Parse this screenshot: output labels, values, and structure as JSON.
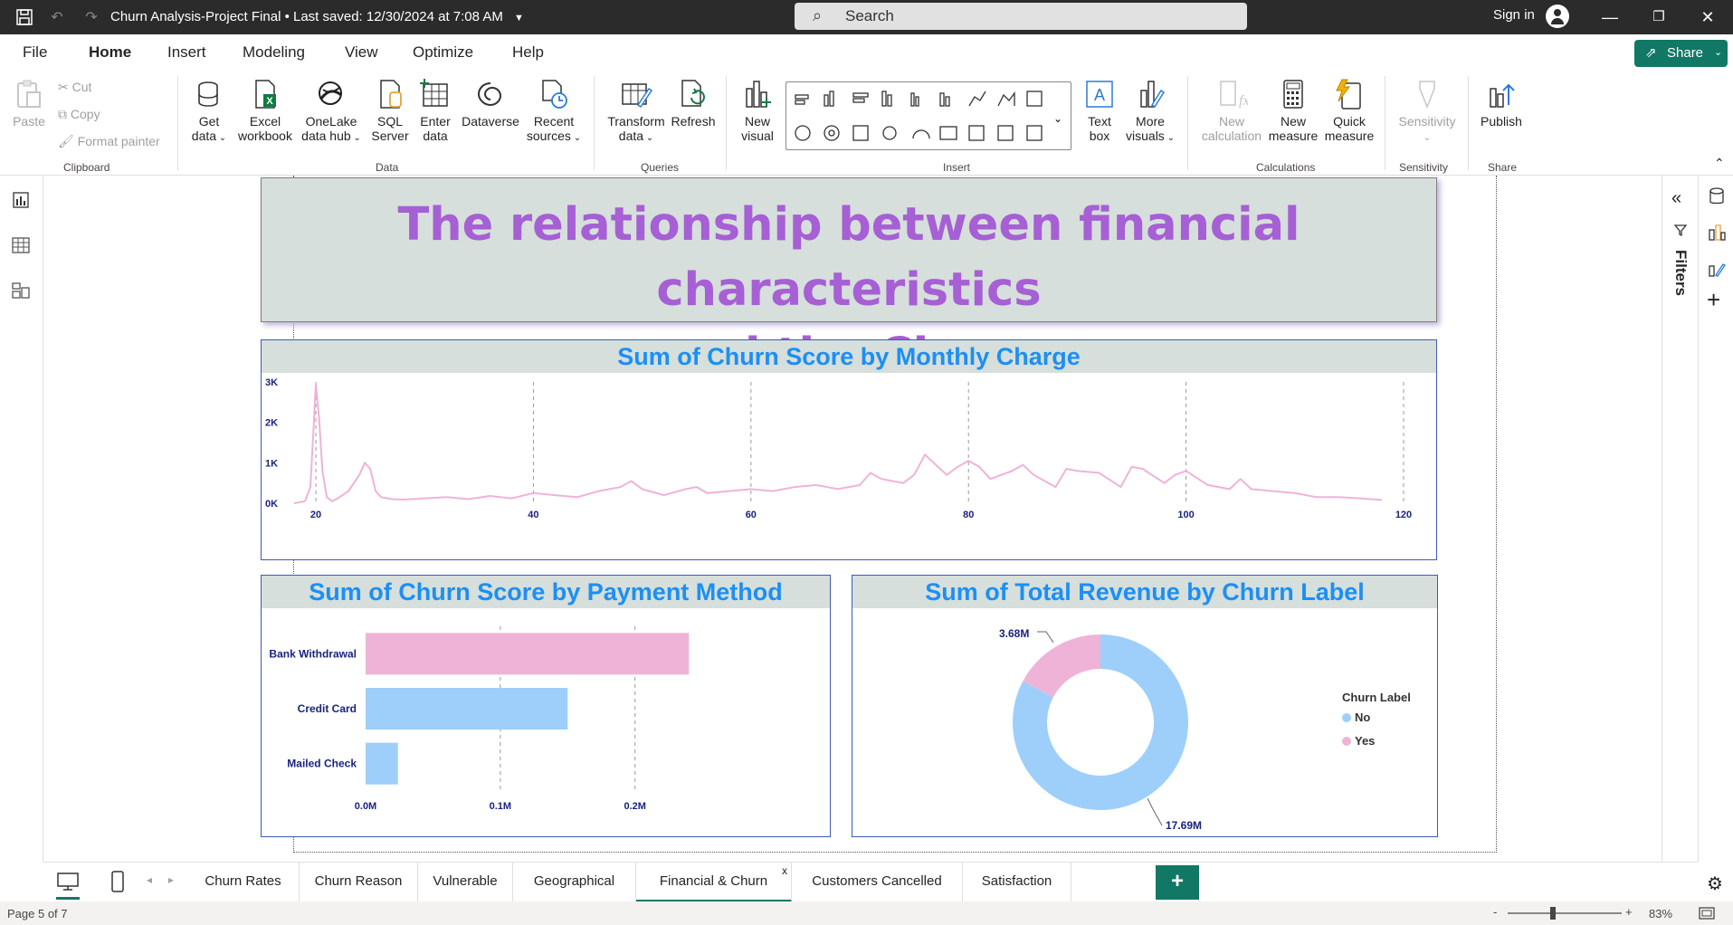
{
  "titlebar": {
    "doc_title": "Churn Analysis-Project Final • Last saved: 12/30/2024 at 7:08 AM",
    "search_placeholder": "Search",
    "sign_in": "Sign in"
  },
  "menu": {
    "items": [
      "File",
      "Home",
      "Insert",
      "Modeling",
      "View",
      "Optimize",
      "Help"
    ],
    "active": "Home",
    "share": "Share"
  },
  "ribbon": {
    "clipboard": {
      "paste": "Paste",
      "cut": "Cut",
      "copy": "Copy",
      "format_painter": "Format painter",
      "group": "Clipboard"
    },
    "data": {
      "get_data": [
        "Get",
        "data"
      ],
      "excel": [
        "Excel",
        "workbook"
      ],
      "onelake": [
        "OneLake",
        "data hub"
      ],
      "sql": [
        "SQL",
        "Server"
      ],
      "enter": [
        "Enter",
        "data"
      ],
      "dataverse": "Dataverse",
      "recent": [
        "Recent",
        "sources"
      ],
      "group": "Data"
    },
    "queries": {
      "transform": [
        "Transform",
        "data"
      ],
      "refresh": "Refresh",
      "group": "Queries"
    },
    "insert": {
      "new_visual": [
        "New",
        "visual"
      ],
      "text_box": [
        "Text",
        "box"
      ],
      "more_visuals": [
        "More",
        "visuals"
      ],
      "group": "Insert"
    },
    "calculations": {
      "new_calc": [
        "New",
        "calculation"
      ],
      "new_measure": [
        "New",
        "measure"
      ],
      "quick_measure": [
        "Quick",
        "measure"
      ],
      "group": "Calculations"
    },
    "sensitivity": {
      "label": "Sensitivity",
      "group": "Sensitivity"
    },
    "share": {
      "publish": "Publish",
      "group": "Share"
    }
  },
  "report": {
    "title": "The relationship between financial characteristics and the Churn",
    "title_line1": "The relationship between financial characteristics",
    "title_line2": "and the Churn"
  },
  "line_visual": {
    "title": "Sum of Churn Score by Monthly Charge"
  },
  "bar_visual": {
    "title": "Sum of Churn Score by Payment Method"
  },
  "donut_visual": {
    "title": "Sum of Total Revenue by Churn Label",
    "legend_title": "Churn Label"
  },
  "chart_data": [
    {
      "type": "line",
      "title": "Sum of Churn Score by Monthly Charge",
      "xlabel": "",
      "ylabel": "",
      "xlim": [
        18,
        120
      ],
      "ylim": [
        0,
        3000
      ],
      "x_ticks": [
        "20",
        "40",
        "60",
        "80",
        "100",
        "120"
      ],
      "y_ticks": [
        "0K",
        "1K",
        "2K",
        "3K"
      ],
      "grid": "vertical dashed",
      "color": "#efb3d8",
      "x": [
        18,
        19,
        19.5,
        19.8,
        20,
        20.3,
        20.6,
        21,
        21.5,
        22,
        23,
        24,
        24.5,
        25,
        25.5,
        26,
        27,
        28,
        30,
        32,
        34,
        36,
        38,
        40,
        42,
        44,
        46,
        48,
        49,
        50,
        52,
        54,
        55,
        56,
        58,
        60,
        62,
        64,
        66,
        68,
        70,
        71,
        72,
        74,
        75,
        76,
        78,
        79,
        80,
        81,
        82,
        84,
        85,
        86,
        88,
        89,
        90,
        92,
        94,
        95,
        96,
        98,
        99,
        100,
        102,
        104,
        105,
        106,
        108,
        110,
        112,
        114,
        116,
        118
      ],
      "y": [
        0,
        50,
        400,
        1900,
        2950,
        2100,
        800,
        150,
        50,
        120,
        300,
        700,
        1000,
        850,
        300,
        150,
        100,
        90,
        120,
        150,
        100,
        180,
        120,
        250,
        200,
        150,
        300,
        400,
        550,
        350,
        200,
        350,
        400,
        250,
        300,
        350,
        300,
        400,
        450,
        350,
        450,
        750,
        600,
        500,
        700,
        1200,
        700,
        900,
        1050,
        900,
        600,
        800,
        950,
        700,
        400,
        850,
        800,
        750,
        400,
        900,
        850,
        500,
        700,
        800,
        450,
        350,
        600,
        350,
        300,
        250,
        150,
        150,
        120,
        80
      ]
    },
    {
      "type": "bar",
      "orientation": "horizontal",
      "title": "Sum of Churn Score by Payment Method",
      "categories": [
        "Bank Withdrawal",
        "Credit Card",
        "Mailed Check"
      ],
      "values": [
        240000,
        150000,
        24000
      ],
      "colors": [
        "#efb3d8",
        "#9dcffa",
        "#9dcffa"
      ],
      "x_ticks": [
        "0.0M",
        "0.1M",
        "0.2M"
      ],
      "xlim": [
        0,
        0.2667
      ]
    },
    {
      "type": "pie",
      "style": "donut",
      "title": "Sum of Total Revenue by Churn Label",
      "legend_title": "Churn Label",
      "legend_position": "right",
      "categories": [
        "No",
        "Yes"
      ],
      "values": [
        17.69,
        3.68
      ],
      "labels": [
        "17.69M",
        "3.68M"
      ],
      "colors": [
        "#9dcffa",
        "#efb3d8"
      ]
    }
  ],
  "page_tabs": [
    "Churn Rates",
    "Churn Reason",
    "Vulnerable",
    "Geographical",
    "Financial & Churn",
    "Customers Cancelled",
    "Satisfaction"
  ],
  "active_tab": "Financial & Churn",
  "status": {
    "page": "Page 5 of 7",
    "zoom": "83%"
  }
}
